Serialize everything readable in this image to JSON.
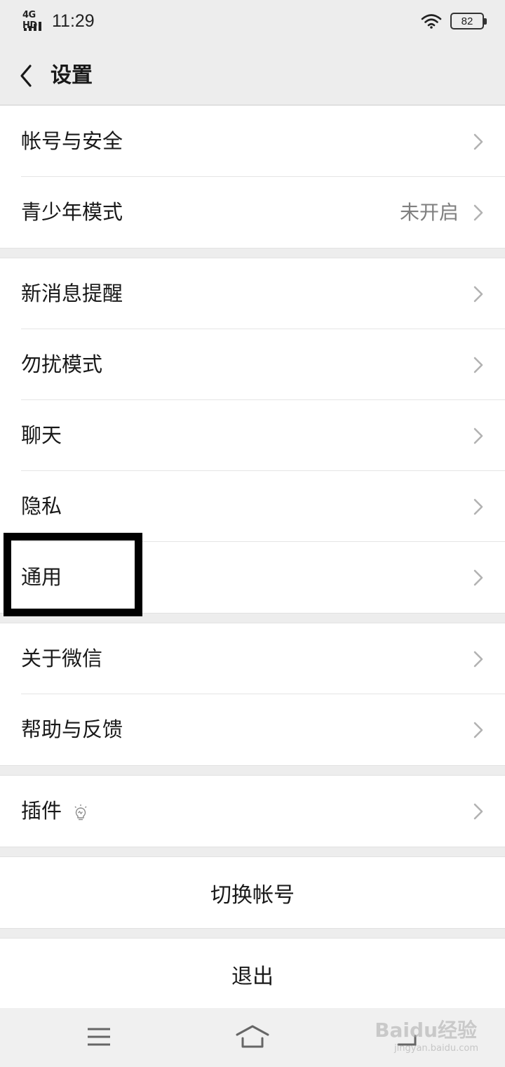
{
  "status_bar": {
    "network": "4G HD",
    "time": "11:29",
    "battery": "82"
  },
  "header": {
    "title": "设置"
  },
  "groups": [
    {
      "items": [
        {
          "label": "帐号与安全",
          "value": ""
        },
        {
          "label": "青少年模式",
          "value": "未开启"
        }
      ]
    },
    {
      "items": [
        {
          "label": "新消息提醒",
          "value": ""
        },
        {
          "label": "勿扰模式",
          "value": ""
        },
        {
          "label": "聊天",
          "value": ""
        },
        {
          "label": "隐私",
          "value": ""
        },
        {
          "label": "通用",
          "value": ""
        }
      ]
    },
    {
      "items": [
        {
          "label": "关于微信",
          "value": ""
        },
        {
          "label": "帮助与反馈",
          "value": ""
        }
      ]
    },
    {
      "items": [
        {
          "label": "插件",
          "value": "",
          "icon": "bulb-icon"
        }
      ]
    }
  ],
  "actions": {
    "switch_account": "切换帐号",
    "logout": "退出"
  },
  "watermark": {
    "logo": "Baidu经验",
    "url": "jingyan.baidu.com"
  },
  "colors": {
    "background": "#ededed",
    "card": "#ffffff",
    "text": "#191919",
    "secondary_text": "#7f7f7f",
    "highlight_border": "#000000"
  }
}
